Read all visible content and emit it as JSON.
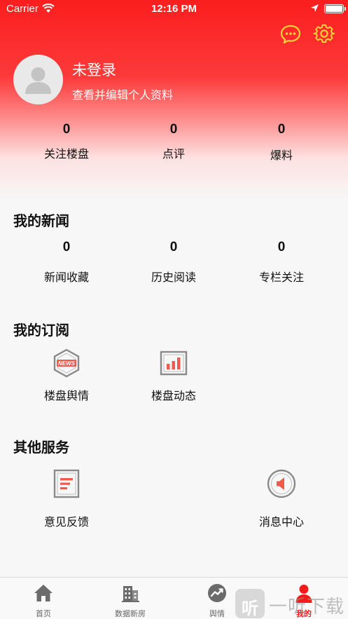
{
  "status_bar": {
    "carrier": "Carrier",
    "time": "12:16 PM"
  },
  "header": {
    "icons": [
      "chat-bubble-icon",
      "gear-icon"
    ],
    "login_title": "未登录",
    "login_subtitle": "查看并编辑个人资料",
    "stats": [
      {
        "value": "0",
        "label": "关注楼盘"
      },
      {
        "value": "0",
        "label": "点评"
      },
      {
        "value": "0",
        "label": "爆料"
      }
    ]
  },
  "my_news": {
    "title": "我的新闻",
    "stats": [
      {
        "value": "0",
        "label": "新闻收藏"
      },
      {
        "value": "0",
        "label": "历史阅读"
      },
      {
        "value": "0",
        "label": "专栏关注"
      }
    ]
  },
  "my_subscriptions": {
    "title": "我的订阅",
    "items": [
      {
        "label": "楼盘舆情",
        "icon": "news-hexagon-icon",
        "badge": "NEWS"
      },
      {
        "label": "楼盘动态",
        "icon": "bar-chart-icon"
      }
    ]
  },
  "other_services": {
    "title": "其他服务",
    "items": [
      {
        "label": "意见反馈",
        "icon": "feedback-document-icon"
      },
      {
        "label": "消息中心",
        "icon": "speaker-icon"
      }
    ]
  },
  "tabbar": {
    "tabs": [
      {
        "label": "首页",
        "icon": "home-icon"
      },
      {
        "label": "数据新房",
        "icon": "building-icon"
      },
      {
        "label": "舆情",
        "icon": "trend-icon"
      },
      {
        "label": "我的",
        "icon": "person-icon",
        "active": true
      }
    ]
  },
  "watermark": {
    "glyph": "听",
    "text": "一听下载"
  },
  "colors": {
    "accent": "#f51a1a",
    "icon_red": "#f05a4a",
    "icon_gray": "#8a8a8a"
  }
}
